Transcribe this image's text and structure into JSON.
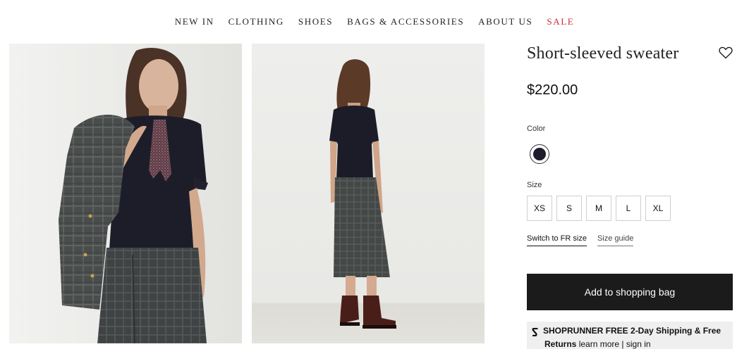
{
  "nav": {
    "items": [
      {
        "label": "NEW IN",
        "name": "nav-item-new-in"
      },
      {
        "label": "CLOTHING",
        "name": "nav-item-clothing"
      },
      {
        "label": "SHOES",
        "name": "nav-item-shoes"
      },
      {
        "label": "BAGS & ACCESSORIES",
        "name": "nav-item-bags-accessories"
      },
      {
        "label": "ABOUT US",
        "name": "nav-item-about-us"
      },
      {
        "label": "SALE",
        "name": "nav-item-sale"
      }
    ],
    "sale_color": "#d0283a"
  },
  "product": {
    "title": "Short-sleeved sweater",
    "price": "$220.00",
    "wishlist_icon": "heart-outline-icon",
    "color_label": "Color",
    "selected_color": "#1e1c2b",
    "size_label": "Size",
    "sizes": [
      "XS",
      "S",
      "M",
      "L",
      "XL"
    ],
    "switch_size_label": "Switch to FR size",
    "size_guide_label": "Size guide",
    "add_to_bag_label": "Add to shopping bag"
  },
  "shoprunner": {
    "icon": "shoprunner-logo-icon",
    "line1": "SHOPRUNNER FREE 2-Day Shipping & Free",
    "returns": "Returns",
    "learn_more": "learn more",
    "separator": "|",
    "sign_in": "sign in"
  },
  "colors": {
    "button_bg": "#1b1b1b",
    "promo_bg": "#efefef"
  }
}
